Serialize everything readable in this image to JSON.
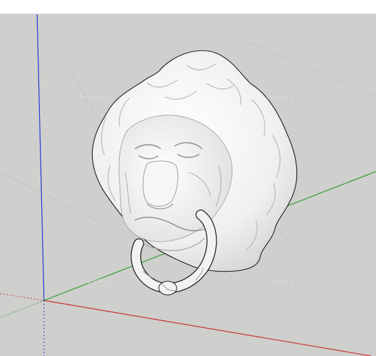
{
  "viewport": {
    "background": "#cfcfcd",
    "axes": {
      "blue_axis_color": "#1f35d6",
      "red_axis_color": "#c8302a",
      "green_axis_color": "#2e9a2e"
    },
    "model": {
      "name": "lion-head-door-knocker",
      "color": "#f2f2f2",
      "edge_color": "#1a1a1a"
    },
    "watermarks": [
      "hiblimer",
      "hiblimer",
      "hiblimer",
      "hiblimer"
    ]
  }
}
